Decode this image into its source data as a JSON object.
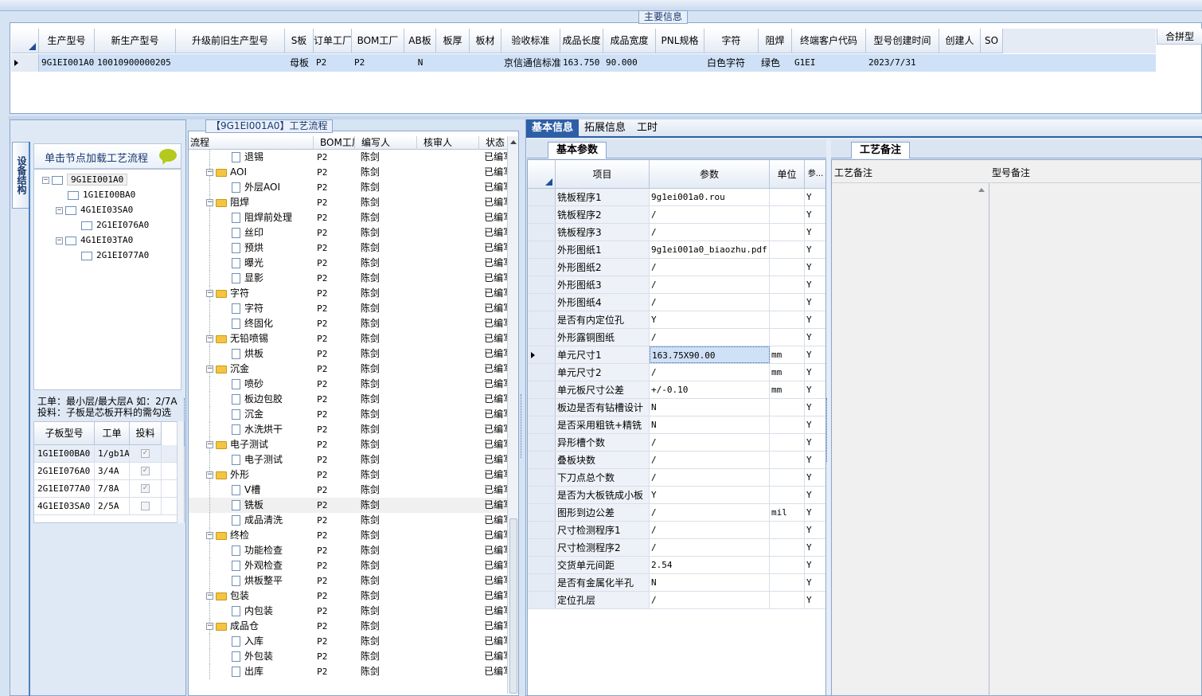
{
  "top_panel": {
    "title": "主要信息",
    "right_header": "合拼型",
    "columns": [
      "生产型号",
      "新生产型号",
      "升级前旧生产型号",
      "S板",
      "订单工厂",
      "BOM工厂",
      "AB板",
      "板厚",
      "板材",
      "验收标准",
      "成品长度",
      "成品宽度",
      "PNL规格",
      "字符",
      "阻焊",
      "终端客户代码",
      "型号创建时间",
      "创建人",
      "SO"
    ],
    "row": {
      "生产型号": "9G1EI001A0",
      "新生产型号": "10010900000205",
      "升级前旧生产型号": "",
      "S板": "母板",
      "订单工厂": "P2",
      "BOM工厂": "P2",
      "AB板": "N",
      "板厚": "",
      "板材": "",
      "验收标准": "京信通信标准",
      "成品长度": "163.750",
      "成品宽度": "90.000",
      "PNL规格": "",
      "字符": "白色字符",
      "阻焊": "绿色",
      "终端客户代码": "G1EI",
      "型号创建时间": "2023/7/31",
      "创建人": "",
      "SO": ""
    }
  },
  "left_panel": {
    "side_tab": "设备结构",
    "hint": "单击节点加载工艺流程",
    "tree": [
      {
        "label": "9G1EI001A0",
        "level": 0
      },
      {
        "label": "1G1EI00BA0",
        "level": 1
      },
      {
        "label": "4G1EI03SA0",
        "level": 1
      },
      {
        "label": "2G1EI076A0",
        "level": 2
      },
      {
        "label": "4G1EI03TA0",
        "level": 1
      },
      {
        "label": "2G1EI077A0",
        "level": 2
      }
    ],
    "note_line1": "工单：最小层/最大层A 如：2/7A",
    "note_line2": "投料：子板是芯板开料的需勾选",
    "sub_columns": [
      "子板型号",
      "工单",
      "投料"
    ],
    "sub_rows": [
      {
        "model": "1G1EI00BA0",
        "order": "1/gb1A",
        "checked": true
      },
      {
        "model": "2G1EI076A0",
        "order": "3/4A",
        "checked": true
      },
      {
        "model": "2G1EI077A0",
        "order": "7/8A",
        "checked": true
      },
      {
        "model": "4G1EI03SA0",
        "order": "2/5A",
        "checked": false
      }
    ]
  },
  "process_panel": {
    "title": "【9G1EI001A0】工艺流程",
    "columns": [
      "流程",
      "BOM工厂",
      "编写人",
      "核审人",
      "状态"
    ],
    "rows": [
      {
        "name": "退锡",
        "type": "doc",
        "factory": "P2",
        "author": "陈剑",
        "status": "已编写"
      },
      {
        "name": "AOI",
        "type": "folder",
        "factory": "P2",
        "author": "陈剑",
        "status": "已编写"
      },
      {
        "name": "外层AOI",
        "type": "doc",
        "factory": "P2",
        "author": "陈剑",
        "status": "已编写"
      },
      {
        "name": "阻焊",
        "type": "folder",
        "factory": "P2",
        "author": "陈剑",
        "status": "已编写"
      },
      {
        "name": "阻焊前处理",
        "type": "doc",
        "factory": "P2",
        "author": "陈剑",
        "status": "已编写"
      },
      {
        "name": "丝印",
        "type": "doc",
        "factory": "P2",
        "author": "陈剑",
        "status": "已编写"
      },
      {
        "name": "预烘",
        "type": "doc",
        "factory": "P2",
        "author": "陈剑",
        "status": "已编写"
      },
      {
        "name": "曝光",
        "type": "doc",
        "factory": "P2",
        "author": "陈剑",
        "status": "已编写"
      },
      {
        "name": "显影",
        "type": "doc",
        "factory": "P2",
        "author": "陈剑",
        "status": "已编写"
      },
      {
        "name": "字符",
        "type": "folder",
        "factory": "P2",
        "author": "陈剑",
        "status": "已编写"
      },
      {
        "name": "字符",
        "type": "doc",
        "factory": "P2",
        "author": "陈剑",
        "status": "已编写"
      },
      {
        "name": "终固化",
        "type": "doc",
        "factory": "P2",
        "author": "陈剑",
        "status": "已编写"
      },
      {
        "name": "无铅喷锡",
        "type": "folder",
        "factory": "P2",
        "author": "陈剑",
        "status": "已编写"
      },
      {
        "name": "烘板",
        "type": "doc",
        "factory": "P2",
        "author": "陈剑",
        "status": "已编写"
      },
      {
        "name": "沉金",
        "type": "folder",
        "factory": "P2",
        "author": "陈剑",
        "status": "已编写"
      },
      {
        "name": "喷砂",
        "type": "doc",
        "factory": "P2",
        "author": "陈剑",
        "status": "已编写"
      },
      {
        "name": "板边包胶",
        "type": "doc",
        "factory": "P2",
        "author": "陈剑",
        "status": "已编写"
      },
      {
        "name": "沉金",
        "type": "doc",
        "factory": "P2",
        "author": "陈剑",
        "status": "已编写"
      },
      {
        "name": "水洗烘干",
        "type": "doc",
        "factory": "P2",
        "author": "陈剑",
        "status": "已编写"
      },
      {
        "name": "电子测试",
        "type": "folder",
        "factory": "P2",
        "author": "陈剑",
        "status": "已编写"
      },
      {
        "name": "电子测试",
        "type": "doc",
        "factory": "P2",
        "author": "陈剑",
        "status": "已编写"
      },
      {
        "name": "外形",
        "type": "folder",
        "factory": "P2",
        "author": "陈剑",
        "status": "已编写"
      },
      {
        "name": "V槽",
        "type": "doc",
        "factory": "P2",
        "author": "陈剑",
        "status": "已编写"
      },
      {
        "name": "铣板",
        "type": "doc",
        "factory": "P2",
        "author": "陈剑",
        "status": "已编写"
      },
      {
        "name": "成品清洗",
        "type": "doc",
        "factory": "P2",
        "author": "陈剑",
        "status": "已编写"
      },
      {
        "name": "终检",
        "type": "folder",
        "factory": "P2",
        "author": "陈剑",
        "status": "已编写"
      },
      {
        "name": "功能检查",
        "type": "doc",
        "factory": "P2",
        "author": "陈剑",
        "status": "已编写"
      },
      {
        "name": "外观检查",
        "type": "doc",
        "factory": "P2",
        "author": "陈剑",
        "status": "已编写"
      },
      {
        "name": "烘板整平",
        "type": "doc",
        "factory": "P2",
        "author": "陈剑",
        "status": "已编写"
      },
      {
        "name": "包装",
        "type": "folder",
        "factory": "P2",
        "author": "陈剑",
        "status": "已编写"
      },
      {
        "name": "内包装",
        "type": "doc",
        "factory": "P2",
        "author": "陈剑",
        "status": "已编写"
      },
      {
        "name": "成品仓",
        "type": "folder",
        "factory": "P2",
        "author": "陈剑",
        "status": "已编写"
      },
      {
        "name": "入库",
        "type": "doc",
        "factory": "P2",
        "author": "陈剑",
        "status": "已编写"
      },
      {
        "name": "外包装",
        "type": "doc",
        "factory": "P2",
        "author": "陈剑",
        "status": "已编写"
      },
      {
        "name": "出库",
        "type": "doc",
        "factory": "P2",
        "author": "陈剑",
        "status": "已编写"
      }
    ]
  },
  "right_panel": {
    "tabs": [
      "基本信息",
      "拓展信息",
      "工时"
    ],
    "subtab": "基本参数",
    "columns": [
      "项目",
      "参数",
      "单位",
      "参..."
    ],
    "rows": [
      {
        "item": "铣板程序1",
        "value": "9g1ei001a0.rou",
        "unit": "",
        "flag": "Y"
      },
      {
        "item": "铣板程序2",
        "value": "/",
        "unit": "",
        "flag": "Y"
      },
      {
        "item": "铣板程序3",
        "value": "/",
        "unit": "",
        "flag": "Y"
      },
      {
        "item": "外形图纸1",
        "value": "9g1ei001a0_biaozhu.pdf",
        "unit": "",
        "flag": "Y"
      },
      {
        "item": "外形图纸2",
        "value": "/",
        "unit": "",
        "flag": "Y"
      },
      {
        "item": "外形图纸3",
        "value": "/",
        "unit": "",
        "flag": "Y"
      },
      {
        "item": "外形图纸4",
        "value": "/",
        "unit": "",
        "flag": "Y"
      },
      {
        "item": "是否有内定位孔",
        "value": "Y",
        "unit": "",
        "flag": "Y"
      },
      {
        "item": "外形露铜图纸",
        "value": "/",
        "unit": "",
        "flag": "Y"
      },
      {
        "item": "单元尺寸1",
        "value": "163.75X90.00",
        "unit": "mm",
        "flag": "Y"
      },
      {
        "item": "单元尺寸2",
        "value": "/",
        "unit": "mm",
        "flag": "Y"
      },
      {
        "item": "单元板尺寸公差",
        "value": "+/-0.10",
        "unit": "mm",
        "flag": "Y"
      },
      {
        "item": "板边是否有钻槽设计",
        "value": "N",
        "unit": "",
        "flag": "Y"
      },
      {
        "item": "是否采用粗铣+精铣",
        "value": "N",
        "unit": "",
        "flag": "Y"
      },
      {
        "item": "异形槽个数",
        "value": "/",
        "unit": "",
        "flag": "Y"
      },
      {
        "item": "叠板块数",
        "value": "/",
        "unit": "",
        "flag": "Y"
      },
      {
        "item": "下刀点总个数",
        "value": "/",
        "unit": "",
        "flag": "Y"
      },
      {
        "item": "是否为大板铣成小板",
        "value": "Y",
        "unit": "",
        "flag": "Y"
      },
      {
        "item": "图形到边公差",
        "value": "/",
        "unit": "mil",
        "flag": "Y"
      },
      {
        "item": "尺寸检测程序1",
        "value": "/",
        "unit": "",
        "flag": "Y"
      },
      {
        "item": "尺寸检测程序2",
        "value": "/",
        "unit": "",
        "flag": "Y"
      },
      {
        "item": "交货单元间距",
        "value": "2.54",
        "unit": "",
        "flag": "Y"
      },
      {
        "item": "是否有金属化半孔",
        "value": "N",
        "unit": "",
        "flag": "Y"
      },
      {
        "item": "定位孔层",
        "value": "/",
        "unit": "",
        "flag": "Y"
      }
    ],
    "notes_tab": "工艺备注",
    "notes_col1": "工艺备注",
    "notes_col2": "型号备注"
  }
}
